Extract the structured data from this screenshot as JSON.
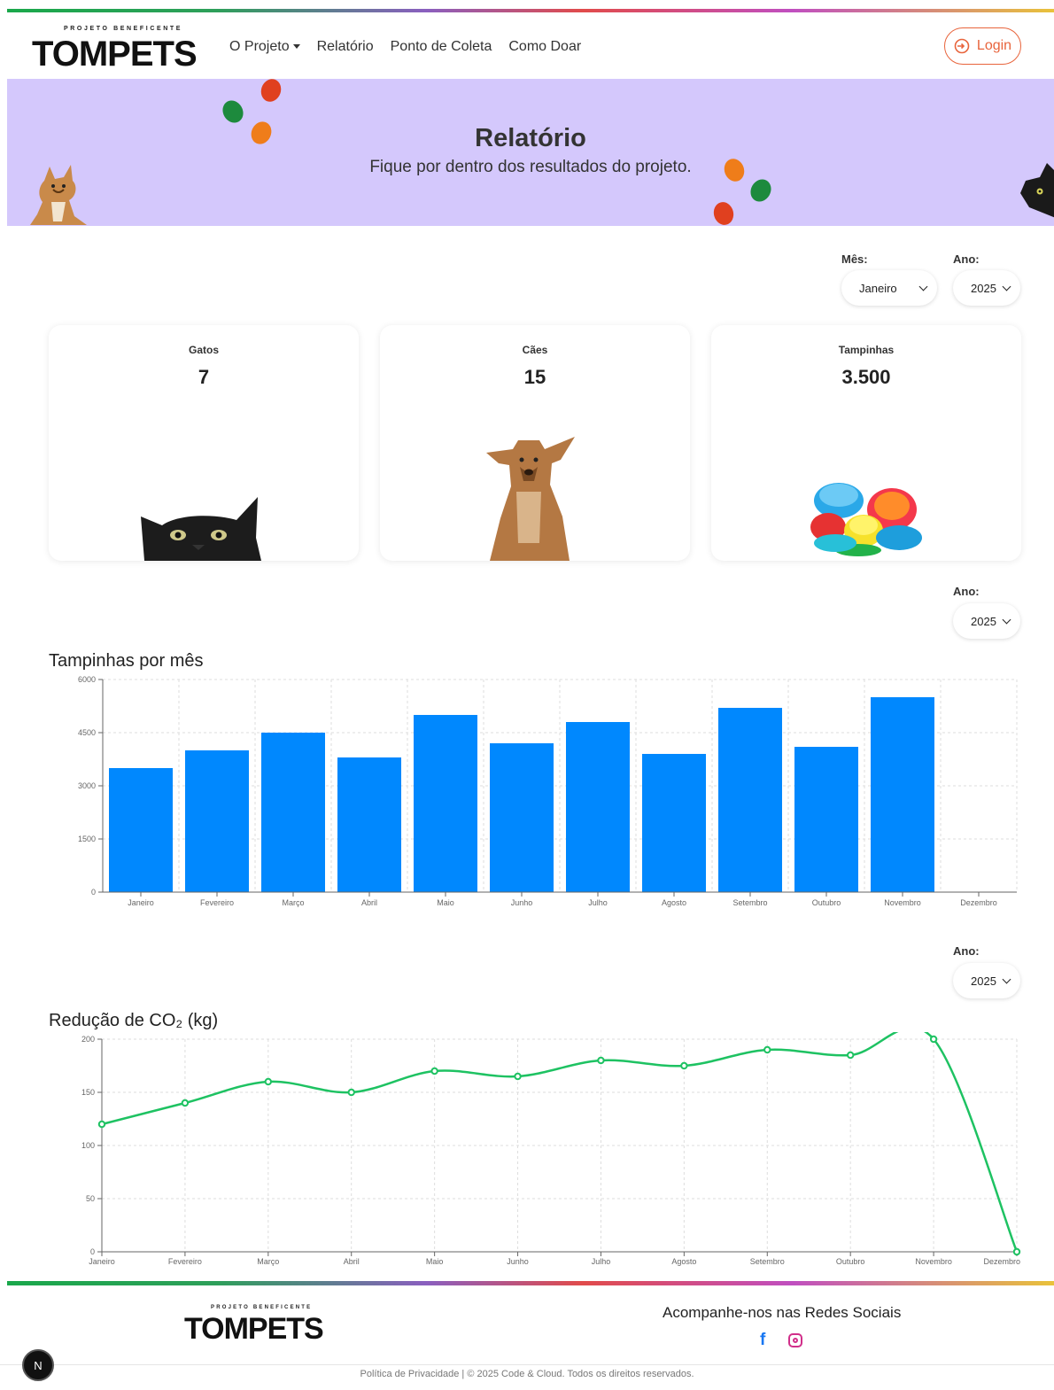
{
  "brand": {
    "pre": "PROJETO BENEFICENTE",
    "name": "TOMPETS"
  },
  "nav": {
    "items": [
      "O Projeto",
      "Relatório",
      "Ponto de Coleta",
      "Como Doar"
    ],
    "login": "Login"
  },
  "hero": {
    "title": "Relatório",
    "subtitle": "Fique por dentro dos resultados do projeto."
  },
  "filters": {
    "month_label": "Mês:",
    "month_value": "Janeiro",
    "year_label": "Ano:",
    "year_value": "2025"
  },
  "cards": [
    {
      "title": "Gatos",
      "value": "7",
      "icon": "cat-peeking"
    },
    {
      "title": "Cães",
      "value": "15",
      "icon": "dog-sitting"
    },
    {
      "title": "Tampinhas",
      "value": "3.500",
      "icon": "bottle-caps"
    }
  ],
  "bar_section": {
    "year_label": "Ano:",
    "year_value": "2025",
    "title": "Tampinhas por mês"
  },
  "line_section": {
    "year_label": "Ano:",
    "year_value": "2025",
    "title": "Redução de CO₂ (kg)"
  },
  "chart_data": [
    {
      "type": "bar",
      "title": "Tampinhas por mês",
      "categories": [
        "Janeiro",
        "Fevereiro",
        "Março",
        "Abril",
        "Maio",
        "Junho",
        "Julho",
        "Agosto",
        "Setembro",
        "Outubro",
        "Novembro",
        "Dezembro"
      ],
      "values": [
        3500,
        4000,
        4500,
        3800,
        5000,
        4200,
        4800,
        3900,
        5200,
        4100,
        5500,
        0
      ],
      "yticks": [
        0,
        1500,
        3000,
        4500,
        6000
      ],
      "ylim": [
        0,
        6000
      ],
      "grid": true,
      "color": "#0088fe"
    },
    {
      "type": "line",
      "title": "Redução de CO₂ (kg)",
      "categories": [
        "Janeiro",
        "Fevereiro",
        "Março",
        "Abril",
        "Maio",
        "Junho",
        "Julho",
        "Agosto",
        "Setembro",
        "Outubro",
        "Novembro",
        "Dezembro"
      ],
      "values": [
        120,
        140,
        160,
        150,
        170,
        165,
        180,
        175,
        190,
        185,
        200,
        0
      ],
      "yticks": [
        0,
        50,
        100,
        150,
        200
      ],
      "ylim": [
        0,
        200
      ],
      "grid": true,
      "color": "#1ec262"
    }
  ],
  "footer": {
    "social_title": "Acompanhe-nos nas Redes Sociais",
    "facebook": "f",
    "copyright": "Política de Privacidade | © 2025 Code & Cloud. Todos os direitos reservados.",
    "badge": "N"
  }
}
